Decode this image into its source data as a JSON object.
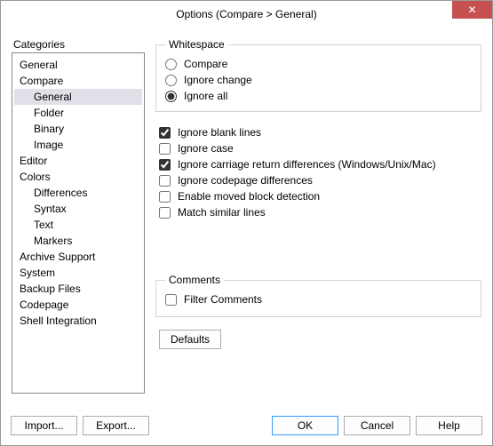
{
  "window": {
    "title": "Options (Compare > General)",
    "close_glyph": "✕"
  },
  "sidebar": {
    "label": "Categories",
    "items": [
      {
        "label": "General",
        "depth": 0,
        "selected": false
      },
      {
        "label": "Compare",
        "depth": 0,
        "selected": false
      },
      {
        "label": "General",
        "depth": 1,
        "selected": true
      },
      {
        "label": "Folder",
        "depth": 1,
        "selected": false
      },
      {
        "label": "Binary",
        "depth": 1,
        "selected": false
      },
      {
        "label": "Image",
        "depth": 1,
        "selected": false
      },
      {
        "label": "Editor",
        "depth": 0,
        "selected": false
      },
      {
        "label": "Colors",
        "depth": 0,
        "selected": false
      },
      {
        "label": "Differences",
        "depth": 1,
        "selected": false
      },
      {
        "label": "Syntax",
        "depth": 1,
        "selected": false
      },
      {
        "label": "Text",
        "depth": 1,
        "selected": false
      },
      {
        "label": "Markers",
        "depth": 1,
        "selected": false
      },
      {
        "label": "Archive Support",
        "depth": 0,
        "selected": false
      },
      {
        "label": "System",
        "depth": 0,
        "selected": false
      },
      {
        "label": "Backup Files",
        "depth": 0,
        "selected": false
      },
      {
        "label": "Codepage",
        "depth": 0,
        "selected": false
      },
      {
        "label": "Shell Integration",
        "depth": 0,
        "selected": false
      }
    ]
  },
  "whitespace": {
    "legend": "Whitespace",
    "options": [
      {
        "label": "Compare",
        "checked": false
      },
      {
        "label": "Ignore change",
        "checked": false
      },
      {
        "label": "Ignore all",
        "checked": true
      }
    ]
  },
  "checks": [
    {
      "label": "Ignore blank lines",
      "checked": true
    },
    {
      "label": "Ignore case",
      "checked": false
    },
    {
      "label": "Ignore carriage return differences (Windows/Unix/Mac)",
      "checked": true
    },
    {
      "label": "Ignore codepage differences",
      "checked": false
    },
    {
      "label": "Enable moved block detection",
      "checked": false
    },
    {
      "label": "Match similar lines",
      "checked": false
    }
  ],
  "comments": {
    "legend": "Comments",
    "filter": {
      "label": "Filter Comments",
      "checked": false
    }
  },
  "buttons": {
    "defaults": "Defaults",
    "import": "Import...",
    "export": "Export...",
    "ok": "OK",
    "cancel": "Cancel",
    "help": "Help"
  }
}
